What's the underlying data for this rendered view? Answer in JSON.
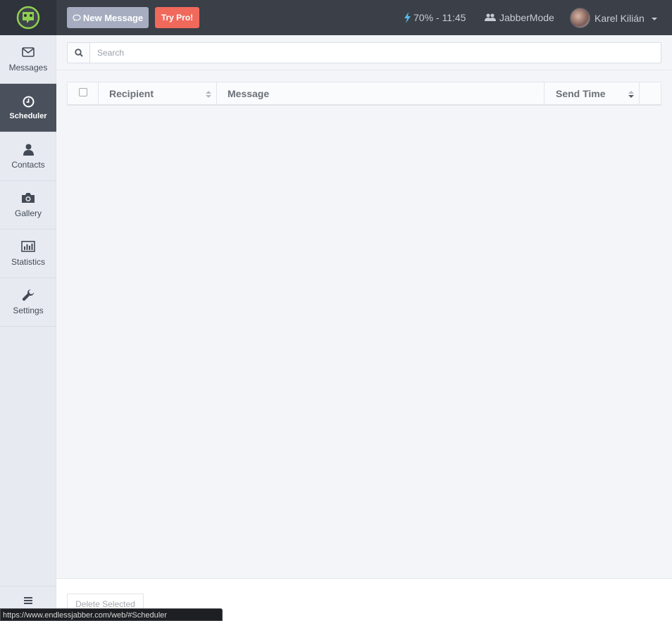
{
  "header": {
    "new_message_label": "New Message",
    "try_pro_label": "Try Pro!",
    "battery_status": "70% - 11:45",
    "mode_label": "JabberMode",
    "user_name": "Karel Kilián"
  },
  "sidebar": {
    "items": [
      {
        "label": "Messages",
        "icon": "envelope-icon"
      },
      {
        "label": "Scheduler",
        "icon": "clock-icon",
        "active": true
      },
      {
        "label": "Contacts",
        "icon": "user-icon"
      },
      {
        "label": "Gallery",
        "icon": "camera-icon"
      },
      {
        "label": "Statistics",
        "icon": "bar-chart-icon"
      },
      {
        "label": "Settings",
        "icon": "wrench-icon"
      }
    ]
  },
  "search": {
    "placeholder": "Search"
  },
  "table": {
    "columns": [
      "Recipient",
      "Message",
      "Send Time"
    ]
  },
  "footer": {
    "delete_label": "Delete Selected"
  },
  "status_bar": {
    "url": "https://www.endlessjabber.com/web/#Scheduler"
  },
  "colors": {
    "topbar": "#3a3f48",
    "sidebar_active": "#4a505c",
    "new_message_button": "#a6adc0",
    "try_pro_button": "#f0695b",
    "logo_green": "#7cc04a"
  }
}
